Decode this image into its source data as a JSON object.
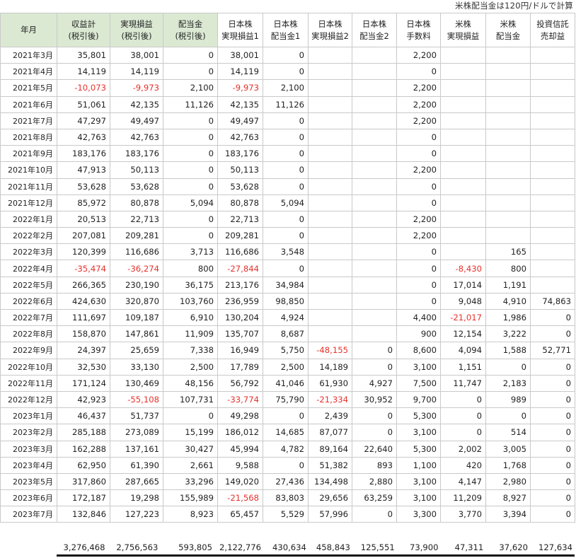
{
  "note": "米株配当金は120円/ドルで計算",
  "headers": [
    {
      "line1": "年月",
      "line2": ""
    },
    {
      "line1": "収益計",
      "line2": "(税引後)"
    },
    {
      "line1": "実現損益",
      "line2": "(税引後)"
    },
    {
      "line1": "配当金",
      "line2": "(税引後)"
    },
    {
      "line1": "日本株",
      "line2": "実現損益1"
    },
    {
      "line1": "日本株",
      "line2": "配当金1"
    },
    {
      "line1": "日本株",
      "line2": "実現損益2"
    },
    {
      "line1": "日本株",
      "line2": "配当金2"
    },
    {
      "line1": "日本株",
      "line2": "手数料"
    },
    {
      "line1": "米株",
      "line2": "実現損益"
    },
    {
      "line1": "米株",
      "line2": "配当金"
    },
    {
      "line1": "投資信託",
      "line2": "売却益"
    }
  ],
  "rows": [
    [
      "2021年3月",
      "35,801",
      "38,001",
      "0",
      "38,001",
      "0",
      "",
      "",
      "2,200",
      "",
      "",
      ""
    ],
    [
      "2021年4月",
      "14,119",
      "14,119",
      "0",
      "14,119",
      "0",
      "",
      "",
      "0",
      "",
      "",
      ""
    ],
    [
      "2021年5月",
      "-10,073",
      "-9,973",
      "2,100",
      "-9,973",
      "2,100",
      "",
      "",
      "2,200",
      "",
      "",
      ""
    ],
    [
      "2021年6月",
      "51,061",
      "42,135",
      "11,126",
      "42,135",
      "11,126",
      "",
      "",
      "2,200",
      "",
      "",
      ""
    ],
    [
      "2021年7月",
      "47,297",
      "49,497",
      "0",
      "49,497",
      "0",
      "",
      "",
      "2,200",
      "",
      "",
      ""
    ],
    [
      "2021年8月",
      "42,763",
      "42,763",
      "0",
      "42,763",
      "0",
      "",
      "",
      "0",
      "",
      "",
      ""
    ],
    [
      "2021年9月",
      "183,176",
      "183,176",
      "0",
      "183,176",
      "0",
      "",
      "",
      "0",
      "",
      "",
      ""
    ],
    [
      "2021年10月",
      "47,913",
      "50,113",
      "0",
      "50,113",
      "0",
      "",
      "",
      "2,200",
      "",
      "",
      ""
    ],
    [
      "2021年11月",
      "53,628",
      "53,628",
      "0",
      "53,628",
      "0",
      "",
      "",
      "0",
      "",
      "",
      ""
    ],
    [
      "2021年12月",
      "85,972",
      "80,878",
      "5,094",
      "80,878",
      "5,094",
      "",
      "",
      "0",
      "",
      "",
      ""
    ],
    [
      "2022年1月",
      "20,513",
      "22,713",
      "0",
      "22,713",
      "0",
      "",
      "",
      "2,200",
      "",
      "",
      ""
    ],
    [
      "2022年2月",
      "207,081",
      "209,281",
      "0",
      "209,281",
      "0",
      "",
      "",
      "2,200",
      "",
      "",
      ""
    ],
    [
      "2022年3月",
      "120,399",
      "116,686",
      "3,713",
      "116,686",
      "3,548",
      "",
      "",
      "0",
      "",
      "165",
      ""
    ],
    [
      "2022年4月",
      "-35,474",
      "-36,274",
      "800",
      "-27,844",
      "0",
      "",
      "",
      "0",
      "-8,430",
      "800",
      ""
    ],
    [
      "2022年5月",
      "266,365",
      "230,190",
      "36,175",
      "213,176",
      "34,984",
      "",
      "",
      "0",
      "17,014",
      "1,191",
      ""
    ],
    [
      "2022年6月",
      "424,630",
      "320,870",
      "103,760",
      "236,959",
      "98,850",
      "",
      "",
      "0",
      "9,048",
      "4,910",
      "74,863"
    ],
    [
      "2022年7月",
      "111,697",
      "109,187",
      "6,910",
      "130,204",
      "4,924",
      "",
      "",
      "4,400",
      "-21,017",
      "1,986",
      "0"
    ],
    [
      "2022年8月",
      "158,870",
      "147,861",
      "11,909",
      "135,707",
      "8,687",
      "",
      "",
      "900",
      "12,154",
      "3,222",
      "0"
    ],
    [
      "2022年9月",
      "24,397",
      "25,659",
      "7,338",
      "16,949",
      "5,750",
      "-48,155",
      "0",
      "8,600",
      "4,094",
      "1,588",
      "52,771"
    ],
    [
      "2022年10月",
      "32,530",
      "33,130",
      "2,500",
      "17,789",
      "2,500",
      "14,189",
      "0",
      "3,100",
      "1,151",
      "0",
      "0"
    ],
    [
      "2022年11月",
      "171,124",
      "130,469",
      "48,156",
      "56,792",
      "41,046",
      "61,930",
      "4,927",
      "7,500",
      "11,747",
      "2,183",
      "0"
    ],
    [
      "2022年12月",
      "42,923",
      "-55,108",
      "107,731",
      "-33,774",
      "75,790",
      "-21,334",
      "30,952",
      "9,700",
      "0",
      "989",
      "0"
    ],
    [
      "2023年1月",
      "46,437",
      "51,737",
      "0",
      "49,298",
      "0",
      "2,439",
      "0",
      "5,300",
      "0",
      "0",
      "0"
    ],
    [
      "2023年2月",
      "285,188",
      "273,089",
      "15,199",
      "186,012",
      "14,685",
      "87,077",
      "0",
      "3,100",
      "0",
      "514",
      "0"
    ],
    [
      "2023年3月",
      "162,288",
      "137,161",
      "30,427",
      "45,994",
      "4,782",
      "89,164",
      "22,640",
      "5,300",
      "2,002",
      "3,005",
      "0"
    ],
    [
      "2023年4月",
      "62,950",
      "61,390",
      "2,661",
      "9,588",
      "0",
      "51,382",
      "893",
      "1,100",
      "420",
      "1,768",
      "0"
    ],
    [
      "2023年5月",
      "317,860",
      "287,665",
      "33,296",
      "149,020",
      "27,436",
      "134,498",
      "2,880",
      "3,100",
      "4,147",
      "2,980",
      "0"
    ],
    [
      "2023年6月",
      "172,187",
      "19,298",
      "155,989",
      "-21,568",
      "83,803",
      "29,656",
      "63,259",
      "3,100",
      "11,209",
      "8,927",
      "0"
    ],
    [
      "2023年7月",
      "132,846",
      "127,223",
      "8,923",
      "65,457",
      "5,529",
      "57,996",
      "0",
      "3,300",
      "3,770",
      "3,394",
      "0"
    ]
  ],
  "totals": [
    "",
    "3,276,468",
    "2,756,563",
    "593,805",
    "2,122,776",
    "430,634",
    "458,843",
    "125,551",
    "73,900",
    "47,311",
    "37,620",
    "127,634"
  ]
}
